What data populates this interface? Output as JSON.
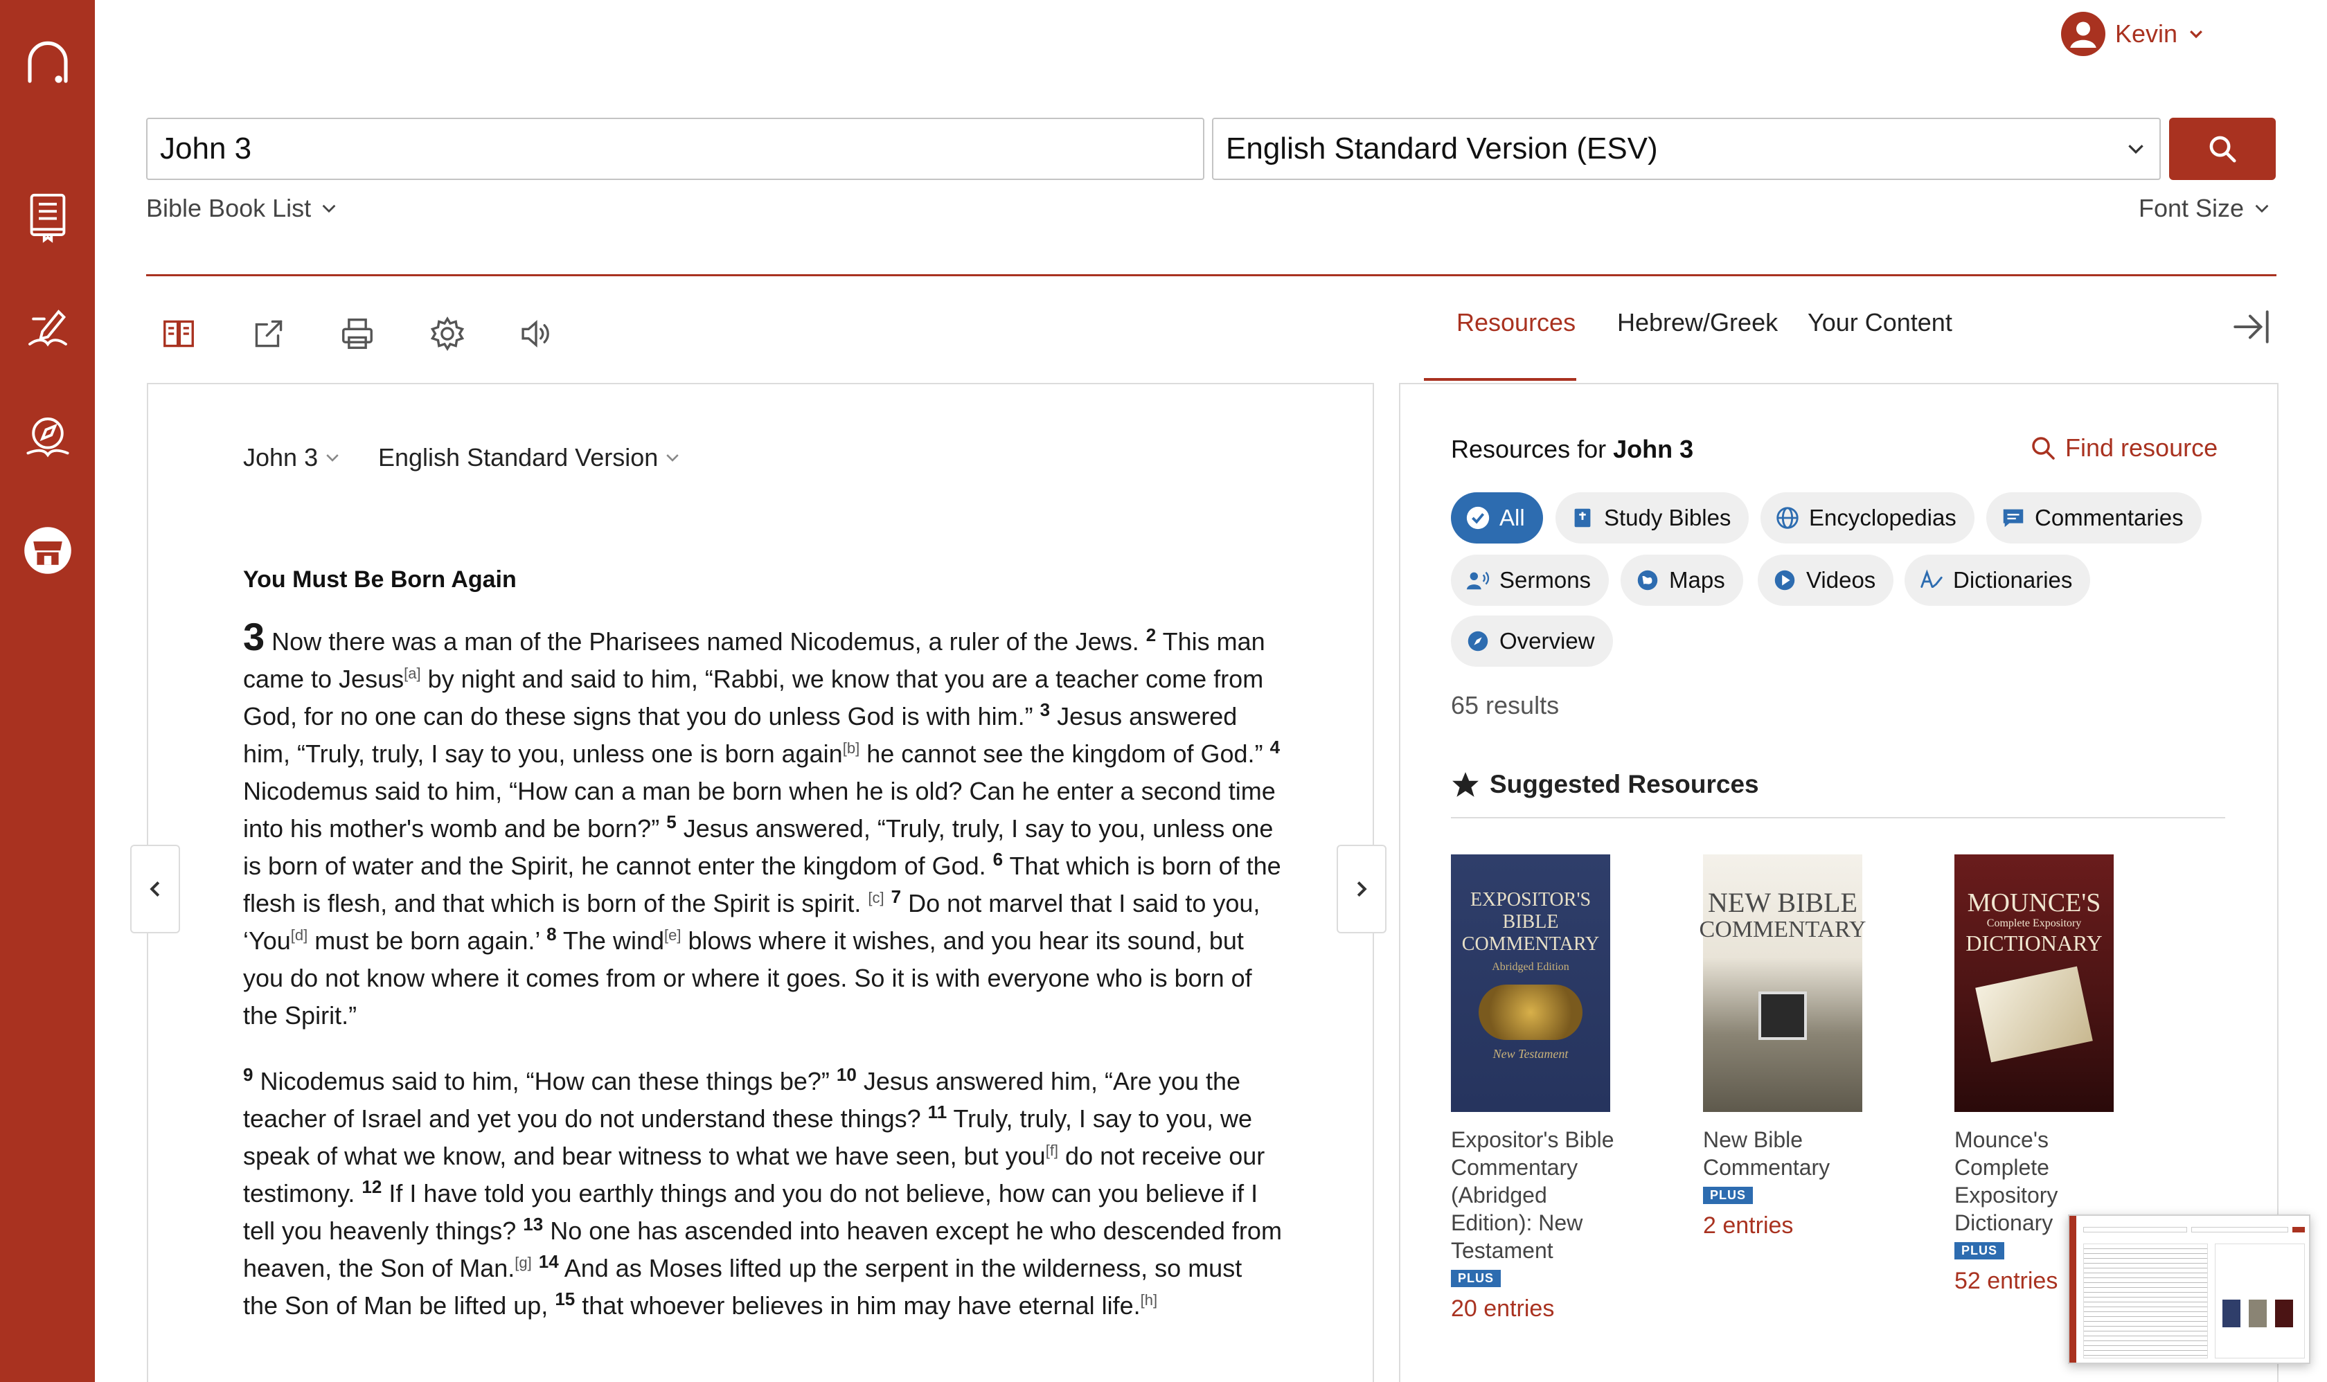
{
  "user": {
    "name": "Kevin"
  },
  "search": {
    "query": "John 3",
    "version": "English Standard Version (ESV)"
  },
  "links": {
    "book_list": "Bible Book List",
    "font_size": "Font Size"
  },
  "tabs": [
    "Resources",
    "Hebrew/Greek",
    "Your Content"
  ],
  "reader": {
    "chapter": "John 3",
    "version": "English Standard Version",
    "heading": "You Must Be Born Again",
    "chapter_number": "3",
    "p1": {
      "t1": "Now there was a man of the Pharisees named Nicodemus, a ruler of the Jews. ",
      "v2": "2",
      "t2": "This man came to Jesus",
      "fa": "[a]",
      "t3": " by night and said to him, “Rabbi, we know that you are a teacher come from God, for no one can do these signs that you do unless God is with him.” ",
      "v3": "3",
      "t4": "Jesus answered him, “Truly, truly, I say to you, unless one is born again",
      "fb": "[b]",
      "t5": " he cannot see the kingdom of God.” ",
      "v4": "4",
      "t6": "Nicodemus said to him, “How can a man be born when he is old? Can he enter a second time into his mother's womb and be born?” ",
      "v5": "5",
      "t7": "Jesus answered, “Truly, truly, I say to you, unless one is born of water and the Spirit, he cannot enter the kingdom of God. ",
      "v6": "6",
      "t8": "That which is born of the flesh is flesh, and that which is born of the Spirit is spirit.",
      "fc": "[c]",
      "v7": "7",
      "t9": "Do not marvel that I said to you, ‘You",
      "fd": "[d]",
      "t10": " must be born again.’ ",
      "v8": "8",
      "t11": "The wind",
      "fe": "[e]",
      "t12": " blows where it wishes, and you hear its sound, but you do not know where it comes from or where it goes. So it is with everyone who is born of the Spirit.”"
    },
    "p2": {
      "v9": "9",
      "t1": "Nicodemus said to him, “How can these things be?” ",
      "v10": "10",
      "t2": "Jesus answered him, “Are you the teacher of Israel and yet you do not understand these things? ",
      "v11": "11",
      "t3": "Truly, truly, I say to you, we speak of what we know, and bear witness to what we have seen, but you",
      "ff": "[f]",
      "t4": " do not receive our testimony. ",
      "v12": "12",
      "t5": "If I have told you earthly things and you do not believe, how can you believe if I tell you heavenly things? ",
      "v13": "13",
      "t6": "No one has ascended into heaven except he who descended from heaven, the Son of Man.",
      "fg": "[g]",
      "v14": "14",
      "t7": "And as Moses lifted up the serpent in the wilderness, so must the Son of Man be lifted up, ",
      "v15": "15",
      "t8": "that whoever believes in him may have eternal life.",
      "fh": "[h]"
    }
  },
  "resources": {
    "title_prefix": "Resources for ",
    "title_ref": "John 3",
    "find": "Find resource",
    "chips": [
      "All",
      "Study Bibles",
      "Encyclopedias",
      "Commentaries",
      "Sermons",
      "Maps",
      "Videos",
      "Dictionaries",
      "Overview"
    ],
    "results": "65 results",
    "suggested": "Suggested Resources",
    "books": [
      {
        "title": "Expositor's Bible Commentary (Abridged Edition): New Testament",
        "badge": "PLUS",
        "entries": "20 entries",
        "cover_l1": "EXPOSITOR'S",
        "cover_l2": "BIBLE",
        "cover_l3": "COMMENTARY",
        "cover_l4": "Abridged Edition",
        "cover_l5": "New Testament"
      },
      {
        "title": "New Bible Commentary",
        "badge": "PLUS",
        "entries": "2 entries",
        "cover_l1": "NEW BIBLE",
        "cover_l2": "COMMENTARY"
      },
      {
        "title": "Mounce's Complete Expository Dictionary",
        "badge": "PLUS",
        "entries": "52 entries",
        "cover_l1": "MOUNCE'S",
        "cover_l2": "Complete Expository",
        "cover_l3": "DICTIONARY"
      }
    ]
  },
  "colors": {
    "brand": "#a93220",
    "chip_active": "#2d6cb0",
    "badge": "#2d6cb0"
  }
}
